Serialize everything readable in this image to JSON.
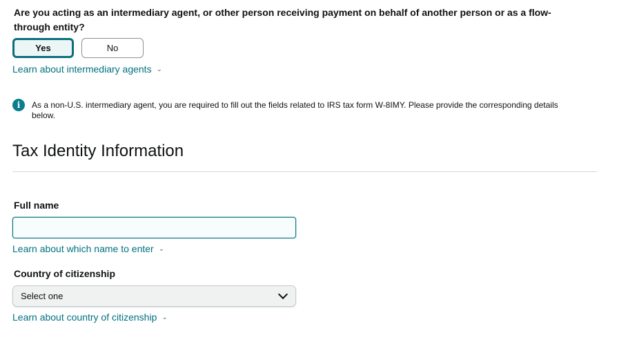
{
  "intermediary": {
    "question": "Are you acting as an intermediary agent, or other person receiving payment on behalf of another person or as a flow-through entity?",
    "yes_label": "Yes",
    "no_label": "No",
    "learn_link": "Learn about intermediary agents"
  },
  "info_alert": {
    "icon": "info-icon",
    "text": "As a non-U.S. intermediary agent, you are required to fill out the fields related to IRS tax form W-8IMY. Please provide the corresponding details below."
  },
  "section": {
    "title": "Tax Identity Information"
  },
  "full_name": {
    "label": "Full name",
    "value": "",
    "learn_link": "Learn about which name to enter"
  },
  "citizenship": {
    "label": "Country of citizenship",
    "selected": "Select one",
    "learn_link": "Learn about country of citizenship"
  },
  "colors": {
    "accent": "#0a6f78",
    "link": "#00707f",
    "info_icon": "#0a7e8c"
  }
}
